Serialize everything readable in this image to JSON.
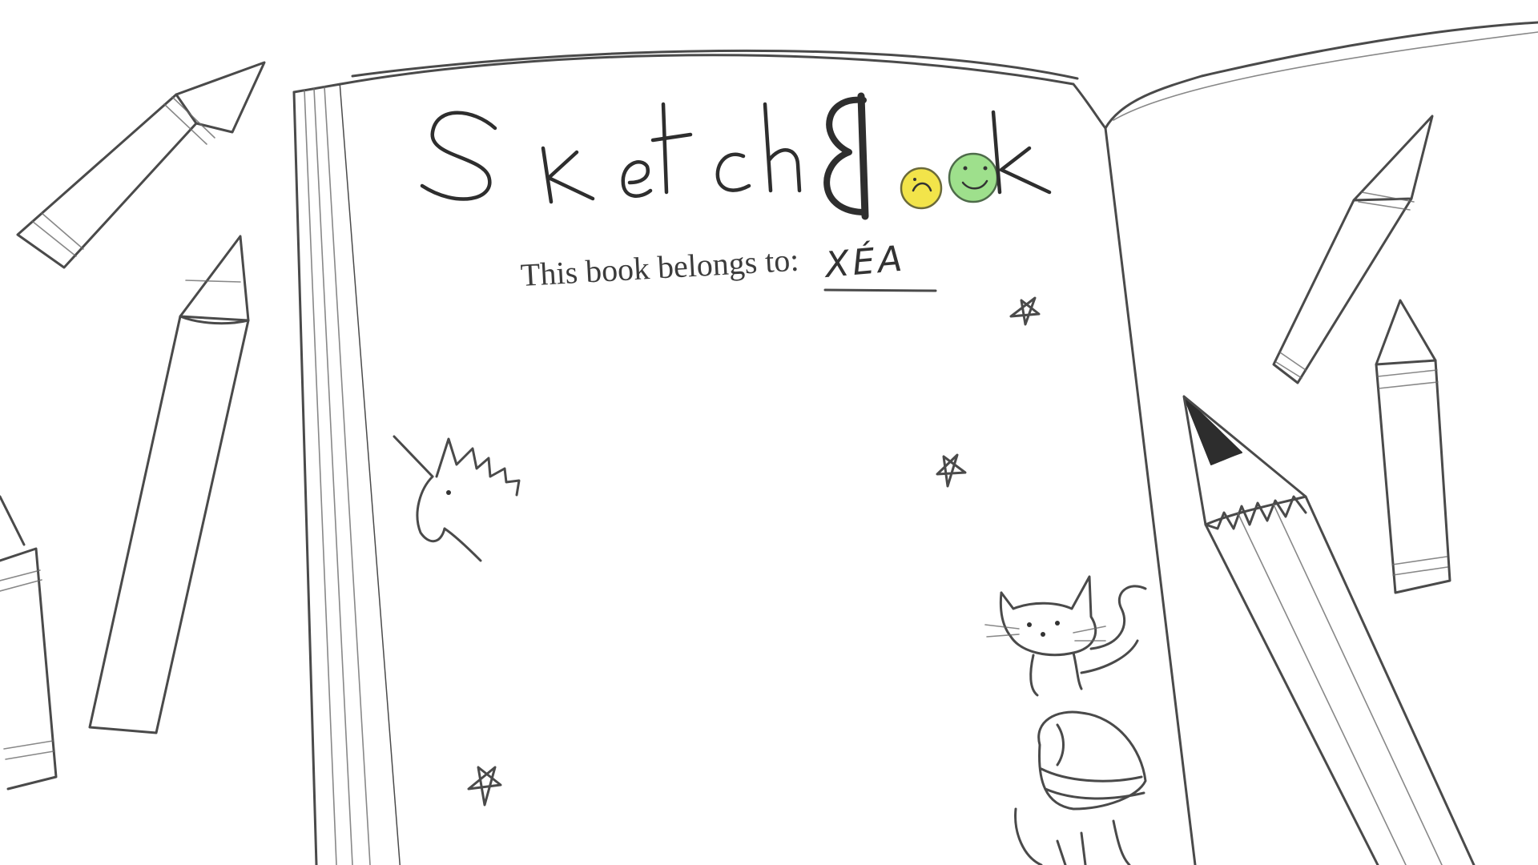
{
  "title": {
    "text": "SketchBook"
  },
  "cover": {
    "belongs_label": "This book belongs to:",
    "owner_name": "XÉA"
  },
  "colors": {
    "sketch_line": "#4a4a4a",
    "paper": "#ffffff",
    "smiley_yellow": "#f2e44a",
    "smiley_green": "#9ee08c"
  },
  "decorations": [
    "crayon-icon",
    "pencil-icon",
    "unicorn-doodle-icon",
    "cat-doodle-icon",
    "star-doodle-icon",
    "smiley-face-icon",
    "gnome-doodle-icon"
  ]
}
